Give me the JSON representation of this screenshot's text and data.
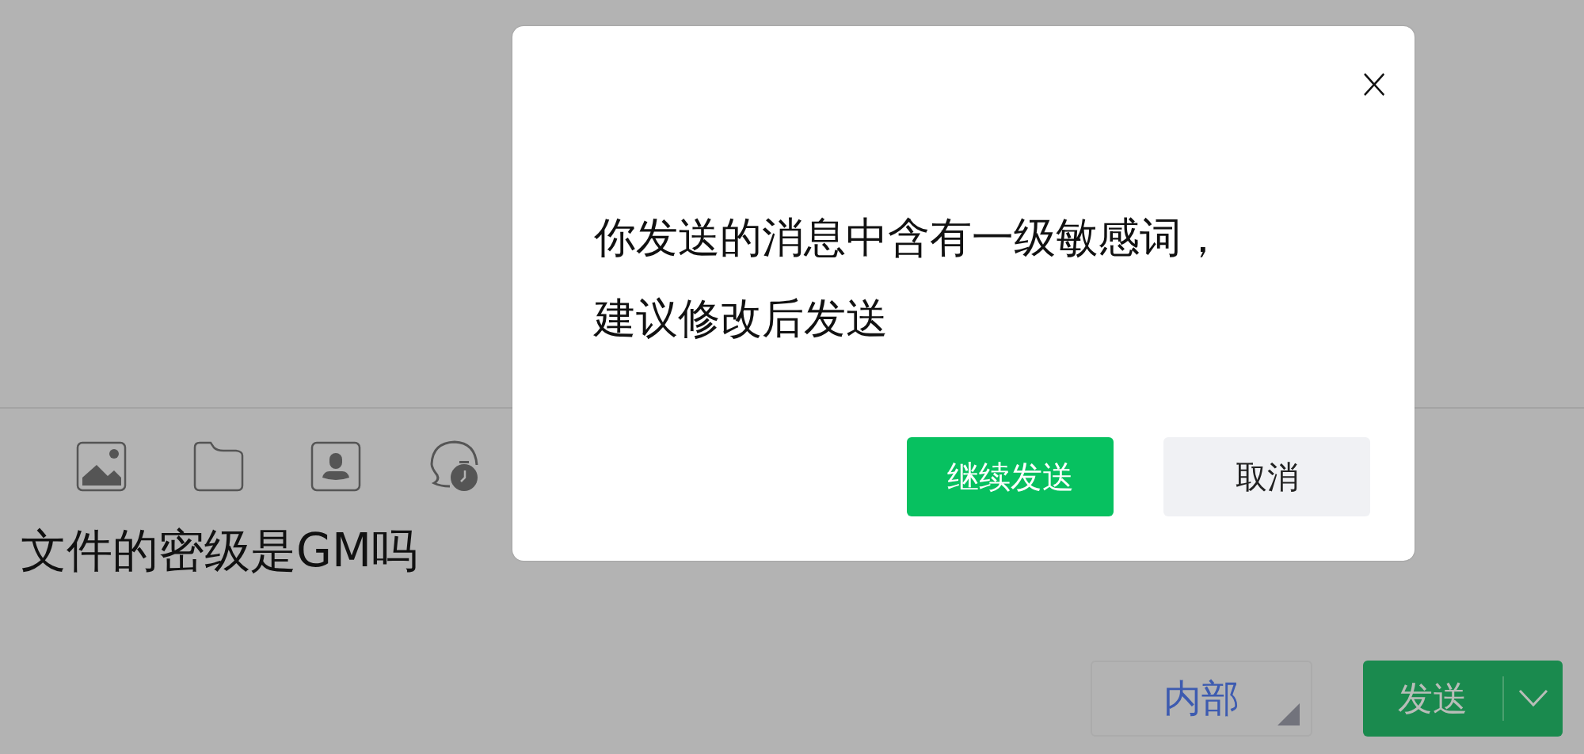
{
  "composer": {
    "message": "文件的密级是GM吗",
    "security_level": "内部",
    "send_button": "发送"
  },
  "dialog": {
    "close": "×",
    "message_lines": [
      "你发送的消息中含有一级敏感词，",
      "建议修改后发送"
    ],
    "buttons": [
      {
        "label": "继续发送",
        "kind": "primary"
      },
      {
        "label": "取消",
        "kind": "secondary"
      }
    ]
  }
}
